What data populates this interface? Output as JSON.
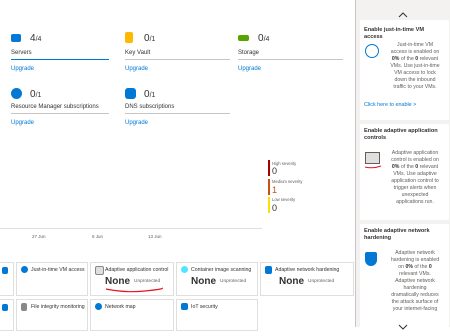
{
  "top_cards": [
    {
      "label": "Servers",
      "count": "4",
      "total": "/4",
      "action": "Upgrade"
    },
    {
      "label": "Key Vault",
      "count": "0",
      "total": "/1",
      "action": "Upgrade"
    },
    {
      "label": "Storage",
      "count": "0",
      "total": "/4",
      "action": "Upgrade"
    },
    {
      "label": "Resource Manager subscriptions",
      "count": "0",
      "total": "/1",
      "action": "Upgrade"
    },
    {
      "label": "DNS subscriptions",
      "count": "0",
      "total": "/1",
      "action": "Upgrade"
    }
  ],
  "chart_data": {
    "type": "line",
    "x_ticks": [
      "27 Jun",
      "6 Jun",
      "13 Jun"
    ],
    "severity": [
      {
        "name": "High severity",
        "value": "0",
        "color": "#a80000"
      },
      {
        "name": "Medium severity",
        "value": "1",
        "color": "#ca5010"
      },
      {
        "name": "Low severity",
        "value": "0",
        "color": "#fce100"
      }
    ]
  },
  "tiles_row1": [
    {
      "label": "Just-in-time VM access",
      "value": "",
      "sub": ""
    },
    {
      "label": "Adaptive application control",
      "value": "None",
      "sub": "Unprotected"
    },
    {
      "label": "Container image scanning",
      "value": "None",
      "sub": "Unprotected"
    },
    {
      "label": "Adaptive network hardening",
      "value": "None",
      "sub": "Unprotected"
    }
  ],
  "tiles_row2": [
    {
      "label": "File integrity monitoring"
    },
    {
      "label": "Network map"
    },
    {
      "label": "IoT security"
    }
  ],
  "side_panel": {
    "cards": [
      {
        "title": "Enable just-in-time VM access",
        "text_pre": "Just-in-time VM access is enabled on ",
        "bold1": "0%",
        "text_mid": " of the ",
        "bold2": "0",
        "text_post": " relevant VMs. Use just-in-time VM access to lock down the inbound traffic to your VMs.",
        "link": "Click here to enable >"
      },
      {
        "title": "Enable adaptive application controls",
        "text_pre": "Adaptive application control is enabled on ",
        "bold1": "0%",
        "text_mid": " of the ",
        "bold2": "0",
        "text_post": " relevant VMs. Use adaptive application control to trigger alerts when unexpected applications run."
      },
      {
        "title": "Enable adaptive network hardening",
        "text_pre": "Adaptive network hardening is enabled on ",
        "bold1": "0%",
        "text_mid": " of the ",
        "bold2": "0",
        "text_post": " relevant VMs. Adaptive network hardening dramatically reduces the attack surface of your internet-facing"
      }
    ]
  }
}
